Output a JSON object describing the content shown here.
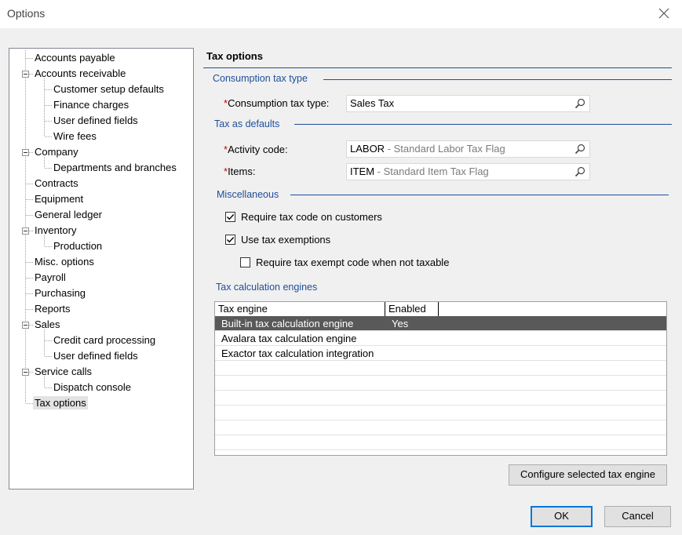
{
  "window": {
    "title": "Options"
  },
  "tree": {
    "items": [
      {
        "label": "Accounts payable"
      },
      {
        "label": "Accounts receivable"
      },
      {
        "label": "Customer setup defaults"
      },
      {
        "label": "Finance charges"
      },
      {
        "label": "User defined fields"
      },
      {
        "label": "Wire fees"
      },
      {
        "label": "Company"
      },
      {
        "label": "Departments and branches"
      },
      {
        "label": "Contracts"
      },
      {
        "label": "Equipment"
      },
      {
        "label": "General ledger"
      },
      {
        "label": "Inventory"
      },
      {
        "label": "Production"
      },
      {
        "label": "Misc. options"
      },
      {
        "label": "Payroll"
      },
      {
        "label": "Purchasing"
      },
      {
        "label": "Reports"
      },
      {
        "label": "Sales"
      },
      {
        "label": "Credit card processing"
      },
      {
        "label": "User defined fields"
      },
      {
        "label": "Service calls"
      },
      {
        "label": "Dispatch console"
      },
      {
        "label": "Tax options"
      }
    ]
  },
  "panel": {
    "title": "Tax options",
    "consumption": {
      "header": "Consumption tax type",
      "required_mark": "*",
      "label": "Consumption tax type:",
      "value": "Sales Tax"
    },
    "defaults": {
      "header": "Tax as defaults",
      "activity": {
        "required_mark": "*",
        "label": "Activity code:",
        "code": "LABOR",
        "desc": " - Standard Labor Tax Flag"
      },
      "items": {
        "required_mark": "*",
        "label": "Items:",
        "code": "ITEM",
        "desc": " - Standard Item Tax Flag"
      }
    },
    "misc": {
      "header": "Miscellaneous",
      "require_tax_code": {
        "label": "Require tax code on customers",
        "checked": true
      },
      "use_exemptions": {
        "label": "Use tax exemptions",
        "checked": true
      },
      "require_exempt_code": {
        "label": "Require tax exempt code when not taxable",
        "checked": false
      }
    },
    "engines": {
      "header": "Tax calculation engines",
      "columns": [
        "Tax engine",
        "Enabled"
      ],
      "rows": [
        {
          "engine": "Built-in tax calculation engine",
          "enabled": "Yes"
        },
        {
          "engine": "Avalara tax calculation engine",
          "enabled": ""
        },
        {
          "engine": "Exactor tax calculation integration",
          "enabled": ""
        }
      ]
    },
    "configure_button": "Configure selected tax engine"
  },
  "footer": {
    "ok": "OK",
    "cancel": "Cancel"
  }
}
